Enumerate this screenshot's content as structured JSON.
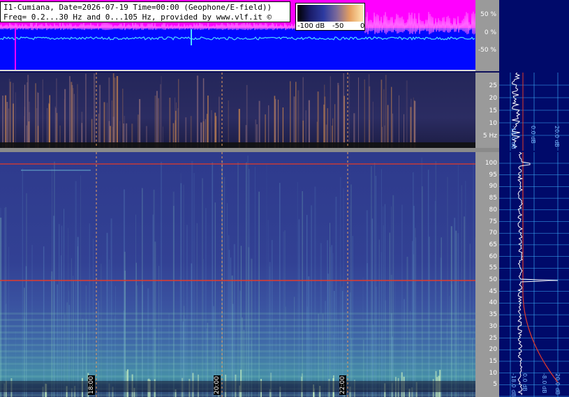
{
  "header": {
    "line1": "I1-Cumiana, Date=2026-07-19 Time=00:00 (Geophone/E-field))",
    "line2": "Freq= 0.2...30 Hz and 0...105 Hz, provided by www.vlf.it ©"
  },
  "colorbar": {
    "labels": [
      "-100 dB",
      "-50",
      "0"
    ]
  },
  "seismograph": {
    "pct_labels": [
      "50 %",
      "0 %",
      "-50 %"
    ]
  },
  "low_axis": {
    "ticks": [
      "25",
      "20",
      "15",
      "10",
      "5 Hz"
    ]
  },
  "main_axis": {
    "ticks": [
      "100",
      "95",
      "90",
      "85",
      "80",
      "75",
      "70",
      "65",
      "60",
      "55",
      "50",
      "45",
      "40",
      "35",
      "30",
      "25",
      "20",
      "15",
      "10",
      "5"
    ]
  },
  "time_labels": [
    "18:00",
    "20:00",
    "22:00"
  ],
  "spectrum_panel_labels": [
    "-18.0 dB",
    "0.0 dB",
    "20.0 dB"
  ],
  "spectrum_panel_labels_main": [
    "-18.0 dB",
    "0.0 dB",
    "-8.0 dB",
    "20.0 dB"
  ],
  "colors": {
    "marker_red": "#e23a2a",
    "time_guide": "#e8a060",
    "spectrum_line": "#ffffff",
    "grid_cyan": "#3fb2ff"
  }
}
